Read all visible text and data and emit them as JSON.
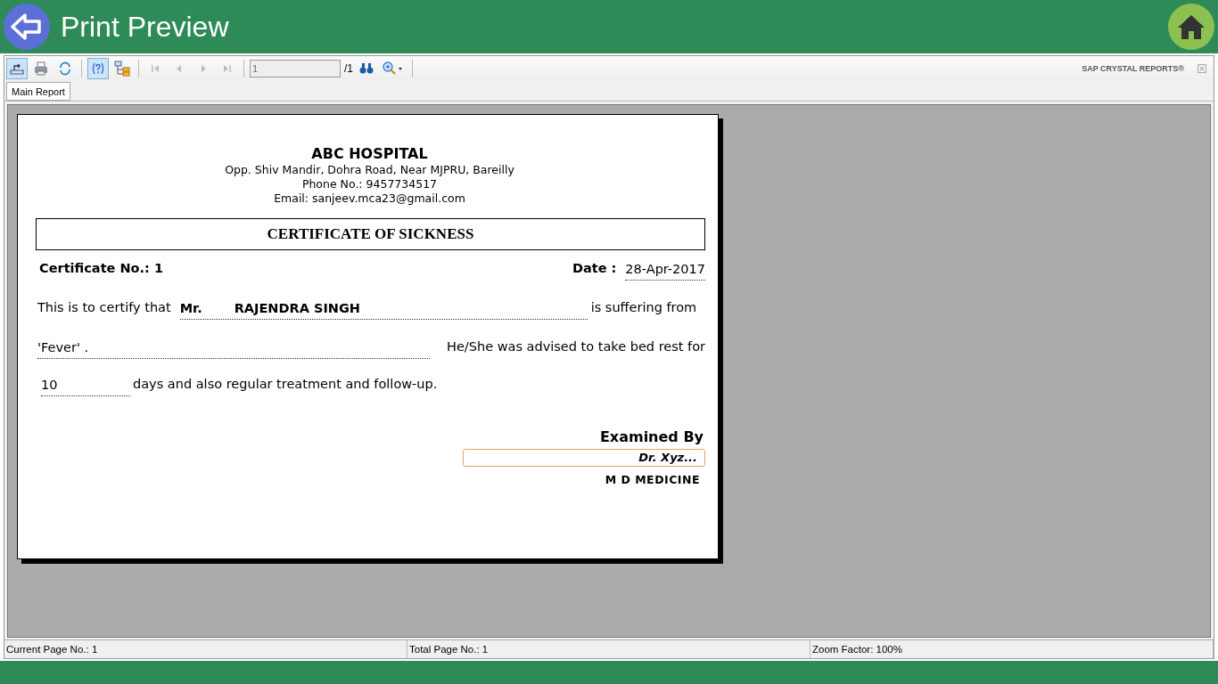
{
  "header": {
    "title": "Print Preview"
  },
  "toolbar": {
    "tools": [
      {
        "kind": "export",
        "on": true,
        "disabled": false
      },
      {
        "kind": "print",
        "on": false,
        "disabled": false
      },
      {
        "kind": "refresh",
        "on": false,
        "disabled": false
      },
      {
        "kind": "sep"
      },
      {
        "kind": "help",
        "on": true,
        "disabled": false
      },
      {
        "kind": "tree",
        "on": false,
        "disabled": false
      },
      {
        "kind": "sep"
      },
      {
        "kind": "first",
        "on": false,
        "disabled": true
      },
      {
        "kind": "prev",
        "on": false,
        "disabled": true
      },
      {
        "kind": "next",
        "on": false,
        "disabled": true
      },
      {
        "kind": "last",
        "on": false,
        "disabled": true
      },
      {
        "kind": "sep"
      },
      {
        "kind": "page"
      },
      {
        "kind": "find",
        "on": false,
        "disabled": false
      },
      {
        "kind": "zoom",
        "on": false,
        "disabled": false
      },
      {
        "kind": "sep"
      }
    ],
    "page_value": "1",
    "page_total": "/1",
    "brand": "SAP CRYSTAL REPORTS®"
  },
  "tabs": [
    {
      "label": "Main Report",
      "selected": true
    }
  ],
  "report": {
    "hospital": "ABC HOSPITAL",
    "address_lines": [
      "Opp. Shiv Mandir, Dohra Road, Near MJPRU, Bareilly",
      "Phone No.: 9457734517",
      "Email: sanjeev.mca23@gmail.com"
    ],
    "title": "CERTIFICATE OF SICKNESS",
    "certificate_label": "Certificate No.: 1",
    "date_label": "Date :",
    "date": "28-Apr-2017",
    "intro": "This is to certify that",
    "salutation": "Mr.",
    "patient": "RAJENDRA SINGH",
    "suffering": "is suffering from",
    "illness": "'Fever' .",
    "advised": "He/She was advised to take bed rest for",
    "days": "10",
    "closing": "days and also regular treatment and follow-up.",
    "examined_by": "Examined By",
    "doctor": "Dr. Xyz...",
    "qualification": "M D MEDICINE"
  },
  "status_bar": [
    "Current Page No.: 1",
    "Total Page No.: 1",
    "Zoom Factor: 100%"
  ]
}
